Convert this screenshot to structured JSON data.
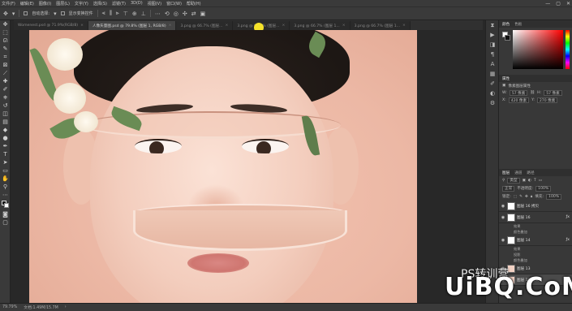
{
  "menubar": {
    "items": [
      "文件(F)",
      "编辑(E)",
      "图像(I)",
      "图层(L)",
      "文字(Y)",
      "选择(S)",
      "滤镜(T)",
      "3D(D)",
      "视图(V)",
      "窗口(W)",
      "帮助(H)"
    ],
    "window_controls": [
      "—",
      "▢",
      "✕"
    ]
  },
  "options_bar": {
    "auto_select_label": "自动选择:",
    "show_transform_label": "显示变换控件"
  },
  "tabs": [
    {
      "label": "Womenest.psd @ 71.9%(RGB/8)",
      "active": false
    },
    {
      "label": "人像矢量图.psd @ 79.8% (图层 1, RGB/8)",
      "active": true
    },
    {
      "label": "3.png @ 66.7% (图层...",
      "active": false
    },
    {
      "label": "3.png @ 66.7% (图层...",
      "active": false
    },
    {
      "label": "3.png @ 66.7% (图层 1...",
      "active": false
    },
    {
      "label": "3.png @ 66.7% (图层 1...",
      "active": false
    }
  ],
  "statusbar": {
    "zoom": "79.79%",
    "doc_info": "文档:1.49M/15.7M"
  },
  "color_panel": {
    "tabs": [
      "颜色",
      "色板"
    ]
  },
  "properties_panel": {
    "title": "属性",
    "subtitle": "像素图层属性",
    "w_label": "W:",
    "w_value": "57 像素",
    "h_label": "H:",
    "h_value": "57 像素",
    "x_label": "X:",
    "x_value": "420 像素",
    "y_label": "Y:",
    "y_value": "270 像素"
  },
  "layers_panel": {
    "tabs": [
      "图层",
      "通道",
      "路径"
    ],
    "kind_label": "类型",
    "blend_mode": "正常",
    "opacity_label": "不透明度:",
    "opacity_value": "100%",
    "lock_label": "锁定:",
    "fill_label": "填充:",
    "fill_value": "100%",
    "layers": [
      {
        "name": "图层 16 拷贝",
        "selected": false,
        "subs": []
      },
      {
        "name": "图层 16",
        "selected": false,
        "subs": [
          "效果",
          "颜色叠加"
        ]
      },
      {
        "name": "图层 14",
        "selected": false,
        "subs": [
          "效果",
          "投影",
          "颜色叠加"
        ]
      },
      {
        "name": "图层 13",
        "selected": false,
        "subs": []
      },
      {
        "name": "图层 10 拷贝",
        "selected": true,
        "subs": []
      }
    ]
  },
  "watermark": {
    "small": "PS转训营",
    "text": "UiBQ.CoM"
  },
  "colors": {
    "chrome_bg": "#3a3a3a",
    "canvas_bg": "#ecb8a5",
    "accent_yellow": "#f5e22a"
  }
}
